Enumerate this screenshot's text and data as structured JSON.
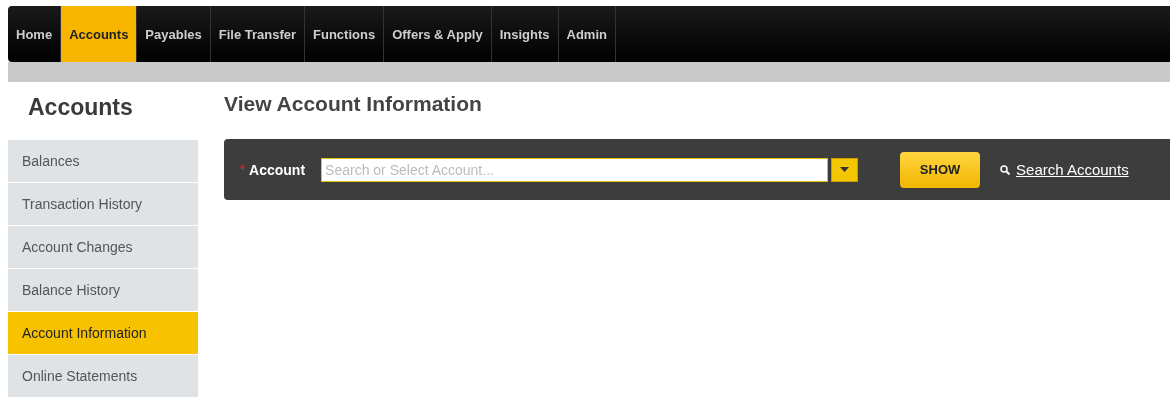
{
  "nav": [
    {
      "label": "Home",
      "selected": false
    },
    {
      "label": "Accounts",
      "selected": true
    },
    {
      "label": "Payables",
      "selected": false
    },
    {
      "label": "File Transfer",
      "selected": false
    },
    {
      "label": "Functions",
      "selected": false
    },
    {
      "label": "Offers & Apply",
      "selected": false
    },
    {
      "label": "Insights",
      "selected": false
    },
    {
      "label": "Admin",
      "selected": false
    }
  ],
  "sidebar": {
    "title": "Accounts",
    "items": [
      {
        "label": "Balances",
        "selected": false
      },
      {
        "label": "Transaction History",
        "selected": false
      },
      {
        "label": "Account Changes",
        "selected": false
      },
      {
        "label": "Balance History",
        "selected": false
      },
      {
        "label": "Account Information",
        "selected": true
      },
      {
        "label": "Online Statements",
        "selected": false
      }
    ]
  },
  "main": {
    "title": "View Account Information",
    "account_field": {
      "required_mark": "*",
      "label": "Account",
      "placeholder": "Search or Select Account..."
    },
    "show_button": "SHOW",
    "search_link": "Search Accounts"
  }
}
